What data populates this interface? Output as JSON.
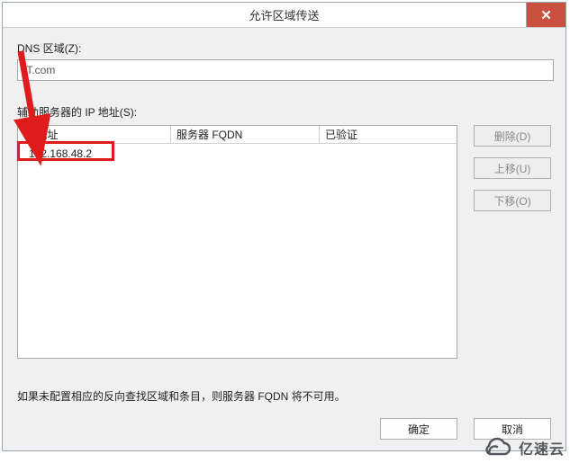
{
  "title": "允许区域传送",
  "dnsZoneLabel": "DNS 区域(Z):",
  "dnsZoneValue": "IT.com",
  "secondaryLabel": "辅助服务器的 IP 地址(S):",
  "columns": {
    "ip": "IP 地址",
    "fqdn": "服务器 FQDN",
    "verified": "已验证"
  },
  "rows": [
    {
      "ip": "192.168.48.2",
      "fqdn": "",
      "verified": ""
    }
  ],
  "buttons": {
    "delete": "删除(D)",
    "moveUp": "上移(U)",
    "moveDown": "下移(O)",
    "ok": "确定",
    "cancel": "取消"
  },
  "note": "如果未配置相应的反向查找区域和条目，则服务器 FQDN 将不可用。",
  "watermark": "亿速云"
}
